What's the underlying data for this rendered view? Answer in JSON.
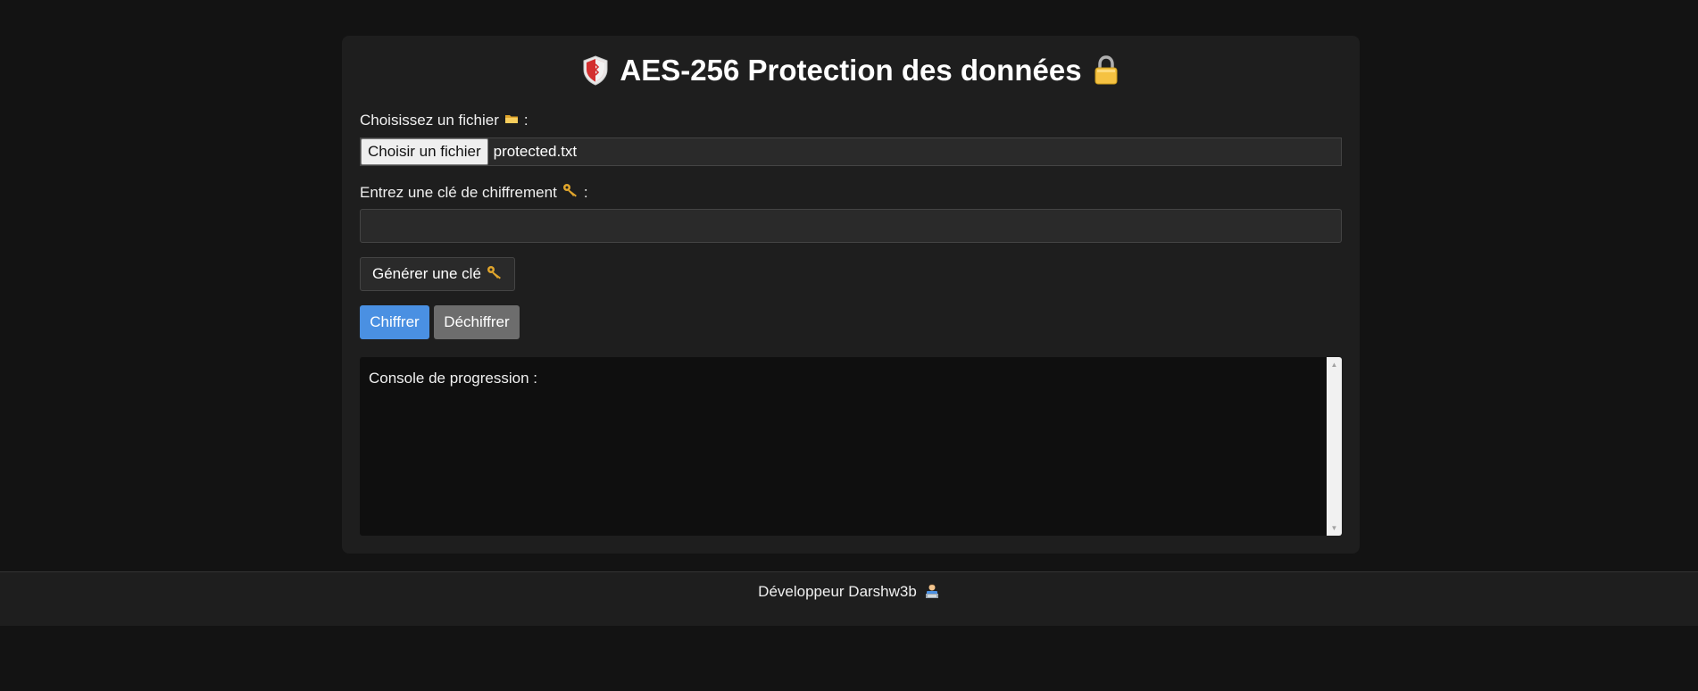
{
  "header": {
    "title": "AES-256 Protection des données",
    "left_icon": "shield-icon",
    "right_icon": "lock-icon"
  },
  "file_section": {
    "label": "Choisissez un fichier",
    "label_icon": "folder-icon",
    "label_suffix": ":",
    "button_label": "Choisir un fichier",
    "file_name": "protected.txt"
  },
  "key_section": {
    "label": "Entrez une clé de chiffrement",
    "label_icon": "key-icon",
    "label_suffix": ":",
    "input_value": ""
  },
  "actions": {
    "generate_label": "Générer une clé",
    "generate_icon": "key-icon",
    "encrypt_label": "Chiffrer",
    "decrypt_label": "Déchiffrer"
  },
  "console": {
    "text": "Console de progression :"
  },
  "footer": {
    "text": "Développeur Darshw3b",
    "icon": "technologist-icon"
  },
  "colors": {
    "page_bg": "#131313",
    "card_bg": "#1e1e1e",
    "accent": "#4a90e2",
    "secondary": "#6d6d6d",
    "console_bg": "#0f0f0f"
  }
}
